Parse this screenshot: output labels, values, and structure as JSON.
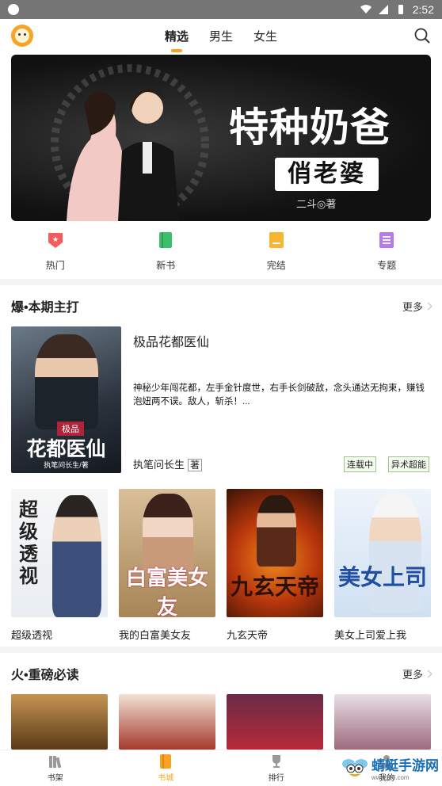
{
  "status_bar": {
    "time": "2:52"
  },
  "top_nav": {
    "tabs": [
      {
        "label": "精选",
        "active": true
      },
      {
        "label": "男生",
        "active": false
      },
      {
        "label": "女生",
        "active": false
      }
    ]
  },
  "banner": {
    "title_line1": "特种奶爸",
    "title_line2": "俏老婆",
    "author_line": "二斗◎著"
  },
  "quick_nav": [
    {
      "label": "热门",
      "icon": "hot-badge-icon",
      "color": "#f25c5c"
    },
    {
      "label": "新书",
      "icon": "new-book-icon",
      "color": "#3dbf6a"
    },
    {
      "label": "完结",
      "icon": "finished-icon",
      "color": "#f7b531"
    },
    {
      "label": "专题",
      "icon": "topic-list-icon",
      "color": "#b57be6"
    }
  ],
  "section1": {
    "title": "爆•本期主打",
    "more": "更多",
    "featured": {
      "title": "极品花都医仙",
      "description": "神秘少年闯花都，左手金针度世，右手长剑破敌，念头通达无拘束，赚钱泡妞两不误。敌人，斩杀！...",
      "author": "执笔问长生",
      "author_suffix": "著",
      "tags": [
        "连载中",
        "异术超能"
      ],
      "cover_small": "极品",
      "cover_main": "花都医仙",
      "cover_author": "执笔问长生/著"
    },
    "books": [
      {
        "name": "超级透视",
        "cover_text": "超级透视"
      },
      {
        "name": "我的白富美女友",
        "cover_text": "白富美女友"
      },
      {
        "name": "九玄天帝",
        "cover_text": "九玄天帝"
      },
      {
        "name": "美女上司爱上我",
        "cover_text": "美女上司"
      }
    ]
  },
  "section2": {
    "title": "火•重磅必读",
    "more": "更多"
  },
  "tab_bar": [
    {
      "label": "书架",
      "icon": "bookshelf-icon",
      "active": false
    },
    {
      "label": "书城",
      "icon": "bookstore-icon",
      "active": true
    },
    {
      "label": "排行",
      "icon": "trophy-icon",
      "active": false
    },
    {
      "label": "我的",
      "icon": "profile-icon",
      "active": false
    }
  ],
  "watermark": {
    "name": "蜻蜓手游网",
    "url": "www.qt6.com"
  }
}
